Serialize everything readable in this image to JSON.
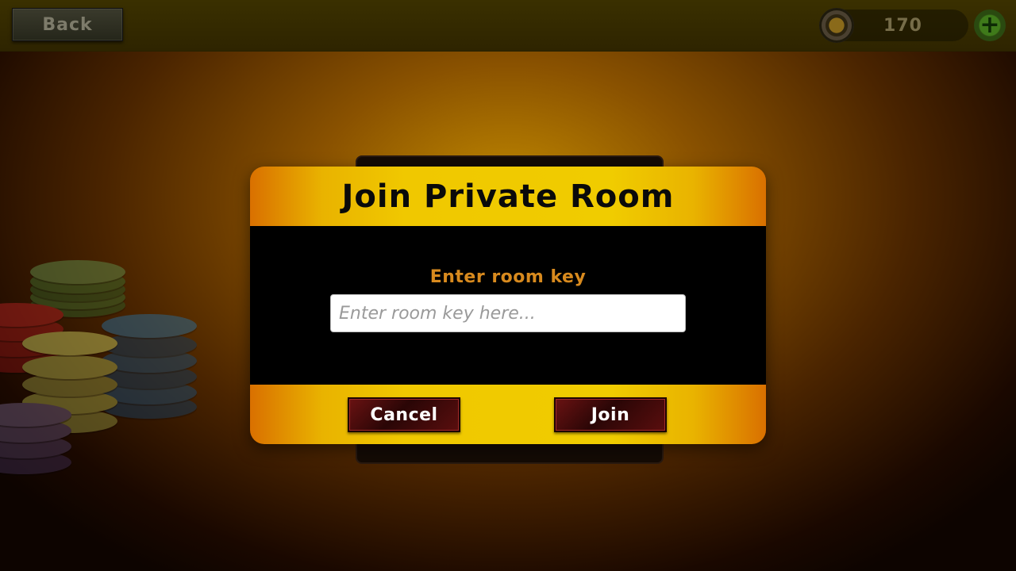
{
  "topbar": {
    "back_label": "Back",
    "coin_count": "170",
    "add_symbol": "+"
  },
  "dialog": {
    "title": "Join Private Room",
    "field_label": "Enter room key",
    "input_placeholder": "Enter room key here...",
    "input_value": "",
    "cancel_label": "Cancel",
    "join_label": "Join"
  },
  "colors": {
    "header_yellow": "#f0c800",
    "header_orange": "#d97000",
    "label_orange": "#d88a1e",
    "button_red": "#5a0e0e"
  },
  "icons": [
    "coin-icon",
    "plus-icon",
    "poker-chips-decoration"
  ]
}
